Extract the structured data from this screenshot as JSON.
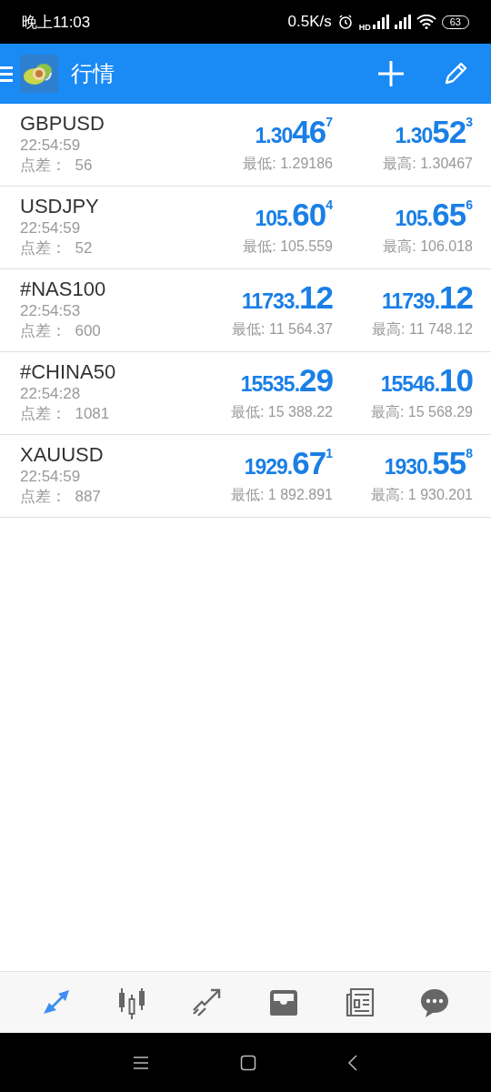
{
  "status_bar": {
    "time": "晚上11:03",
    "speed": "0.5K/s",
    "hd": "HD",
    "battery": "63"
  },
  "header": {
    "title": "行情"
  },
  "quotes": [
    {
      "symbol": "GBPUSD",
      "time": "22:54:59",
      "spread_label": "点差：",
      "spread": "56",
      "bid": {
        "prefix": "1.30",
        "big": "46",
        "sup": "7"
      },
      "ask": {
        "prefix": "1.30",
        "big": "52",
        "sup": "3"
      },
      "low": "最低: 1.29186",
      "high": "最高: 1.30467"
    },
    {
      "symbol": "USDJPY",
      "time": "22:54:59",
      "spread_label": "点差：",
      "spread": "52",
      "bid": {
        "prefix": "105.",
        "big": "60",
        "sup": "4"
      },
      "ask": {
        "prefix": "105.",
        "big": "65",
        "sup": "6"
      },
      "low": "最低: 105.559",
      "high": "最高: 106.018"
    },
    {
      "symbol": "#NAS100",
      "time": "22:54:53",
      "spread_label": "点差：",
      "spread": "600",
      "bid": {
        "prefix": "11733.",
        "big": "12"
      },
      "ask": {
        "prefix": "11739.",
        "big": "12"
      },
      "low": "最低: 11 564.37",
      "high": "最高: 11 748.12"
    },
    {
      "symbol": "#CHINA50",
      "time": "22:54:28",
      "spread_label": "点差：",
      "spread": "1081",
      "bid": {
        "prefix": "15535.",
        "big": "29"
      },
      "ask": {
        "prefix": "15546.",
        "big": "10"
      },
      "low": "最低: 15 388.22",
      "high": "最高: 15 568.29"
    },
    {
      "symbol": "XAUUSD",
      "time": "22:54:59",
      "spread_label": "点差：",
      "spread": "887",
      "bid": {
        "prefix": "1929.",
        "big": "67",
        "sup": "1"
      },
      "ask": {
        "prefix": "1930.",
        "big": "55",
        "sup": "8"
      },
      "low": "最低: 1 892.891",
      "high": "最高: 1 930.201"
    }
  ],
  "bottom_nav": [
    {
      "kind": "quotes",
      "selected": true
    },
    {
      "kind": "chart",
      "selected": false
    },
    {
      "kind": "trade",
      "selected": false
    },
    {
      "kind": "history",
      "selected": false
    },
    {
      "kind": "news",
      "selected": false
    },
    {
      "kind": "messages",
      "selected": false
    }
  ]
}
